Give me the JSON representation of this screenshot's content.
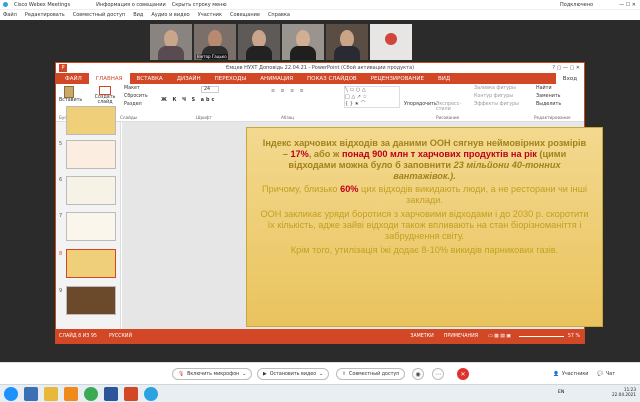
{
  "webex": {
    "app_title": "Cisco Webex Meetings",
    "share_status": "Информация о совещании",
    "hide_menu": "Скрыть строку меню",
    "connected": "Подключено",
    "menu": [
      "Файл",
      "Редактировать",
      "Совместный доступ",
      "Вид",
      "Аудио и видео",
      "Участник",
      "Совещание",
      "Справка"
    ],
    "participant_label": "Віктор Гацько",
    "controls": {
      "mic": "Включить микрофон",
      "video": "Остановить видео",
      "share": "Совместный доступ",
      "participants": "Участники",
      "chat": "Чат"
    }
  },
  "ppt": {
    "title": "Ємцев НУХТ Доповідь 22.04.21 - PowerPoint (Сбой активации продукта)",
    "tabs": [
      "ФАЙЛ",
      "ГЛАВНАЯ",
      "ВСТАВКА",
      "ДИЗАЙН",
      "ПЕРЕХОДЫ",
      "АНИМАЦИЯ",
      "ПОКАЗ СЛАЙДОВ",
      "РЕЦЕНЗИРОВАНИЕ",
      "ВИД"
    ],
    "login": "Вход",
    "ribbon": {
      "paste": "Вставить",
      "create_slide": "Создать слайд",
      "layout": "Макет",
      "reset": "Сбросить",
      "section": "Раздел",
      "font_size": "24",
      "arrange": "Упорядочить",
      "quick_styles": "Экспресс-стили",
      "shape_fill": "Заливка фигуры",
      "shape_outline": "Контур фигуры",
      "shape_effects": "Эффекты фигуры",
      "find": "Найти",
      "replace": "Заменить",
      "select": "Выделить",
      "groups": {
        "clipboard": "Буфер обмена",
        "slides": "Слайды",
        "font": "Шрифт",
        "paragraph": "Абзац",
        "drawing": "Рисование",
        "editing": "Редактирование"
      }
    },
    "slide_numbers": [
      "5",
      "6",
      "7",
      "8",
      "9"
    ],
    "slide": {
      "p1_a": "Індекс харчових відходів за даними ООН сягнув неймовірних розмірів – ",
      "p1_pct": "17%",
      "p1_b": ", або ж ",
      "p1_c": "понад 900 млн т харчових продуктів на рік",
      "p1_d": " (цими відходами можна було б заповнити ",
      "p1_e": "23 мільйони 40-тонних вантажівок.)",
      "p1_f": ".",
      "p2_a": "Причому, близько ",
      "p2_pct": "60%",
      "p2_b": " цих відходів викидають люди, а не ресторани чи інші заклади.",
      "p3": "ООН закликає уряди боротися з харчовими відходами і до 2030 р. скоротити їх кількість, адже зайві відходи також впливають на стан біорізноманіття і забруднення світу.",
      "p4": "Крім того, утилізація їжі додає 8-10% викидів парникових газів."
    },
    "status": {
      "slide_info": "СЛАЙД 8 ИЗ 95",
      "language": "РУССКИЙ",
      "notes": "ЗАМЕТКИ",
      "comments": "ПРИМЕЧАНИЯ",
      "zoom": "57 %"
    }
  },
  "taskbar": {
    "lang": "EN",
    "time": "11:23",
    "date": "22.04.2021"
  },
  "colors": {
    "ppt_accent": "#d24726",
    "slide_bg": "#f0cf7a",
    "slide_text": "#c2a020",
    "highlight_red": "#c0001b",
    "end_call": "#e0322d"
  }
}
